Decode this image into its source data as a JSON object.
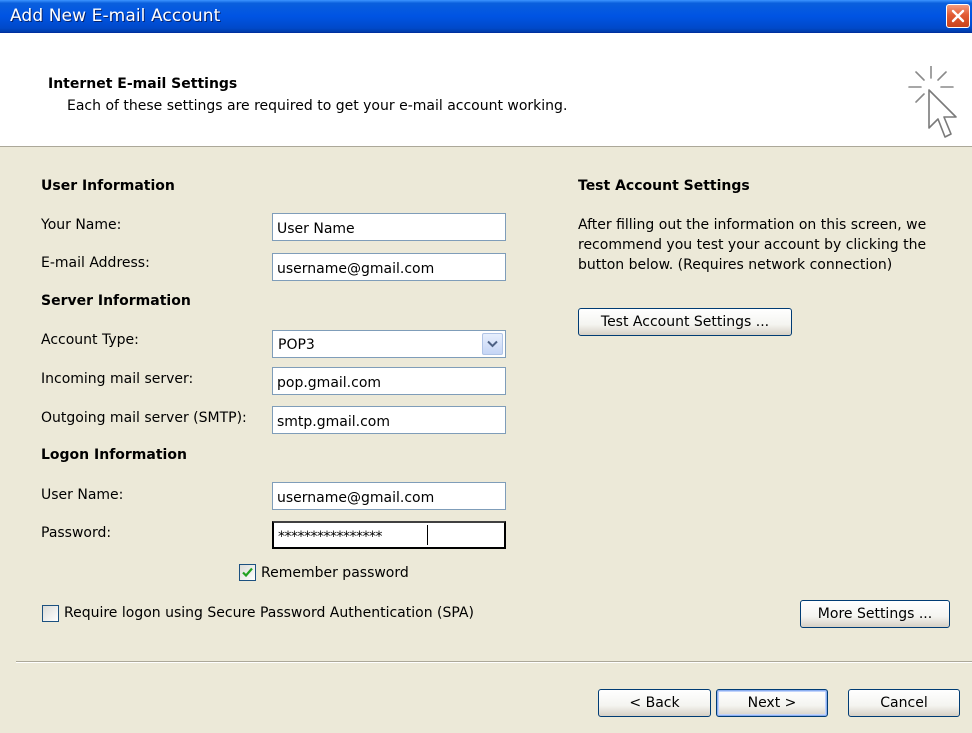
{
  "window": {
    "title": "Add New E-mail Account"
  },
  "header": {
    "title": "Internet E-mail Settings",
    "subtitle": "Each of these settings are required to get your e-mail account working."
  },
  "user_info": {
    "heading": "User Information",
    "name_label": "Your Name:",
    "name_value": "User Name",
    "email_label": "E-mail Address:",
    "email_value": "username@gmail.com"
  },
  "server_info": {
    "heading": "Server Information",
    "account_type_label": "Account Type:",
    "account_type_value": "POP3",
    "incoming_label": "Incoming mail server:",
    "incoming_value": "pop.gmail.com",
    "outgoing_label": "Outgoing mail server (SMTP):",
    "outgoing_value": "smtp.gmail.com"
  },
  "logon_info": {
    "heading": "Logon Information",
    "username_label": "User Name:",
    "username_value": "username@gmail.com",
    "password_label": "Password:",
    "password_value": "****************",
    "remember_label": "Remember password",
    "remember_checked": true,
    "spa_label": "Require logon using Secure Password Authentication (SPA)",
    "spa_checked": false
  },
  "test_settings": {
    "heading": "Test Account Settings",
    "description": "After filling out the information on this screen, we recommend you test your account by clicking the button below. (Requires network connection)",
    "button_label": "Test Account Settings ..."
  },
  "buttons": {
    "more_settings": "More Settings ...",
    "back": "< Back",
    "next": "Next >",
    "cancel": "Cancel"
  },
  "colors": {
    "titlebar": "#0054E3",
    "dialog_bg": "#ECE9D8",
    "close_button": "#E25B33",
    "check_mark": "#21A121"
  },
  "icons": {
    "header_graphic": "sparkle-cursor-icon",
    "close": "close-icon",
    "dropdown": "chevron-down-icon",
    "check": "check-icon"
  }
}
